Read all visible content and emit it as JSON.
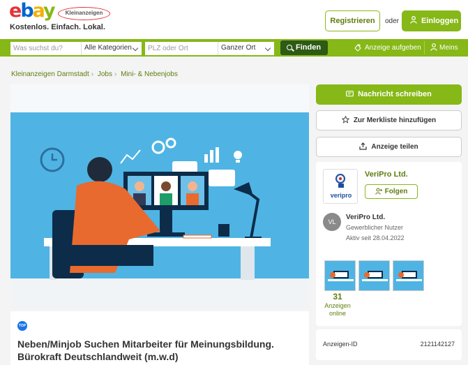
{
  "header": {
    "logo_ebay": "ebay",
    "logo_badge": "Kleinanzeigen",
    "tagline": "Kostenlos. Einfach. Lokal.",
    "register_label": "Registrieren",
    "or_label": "oder",
    "login_label": "Einloggen"
  },
  "search": {
    "query_placeholder": "Was suchst du?",
    "category_value": "Alle Kategorien",
    "location_placeholder": "PLZ oder Ort",
    "radius_value": "Ganzer Ort",
    "find_label": "Finden",
    "post_ad_label": "Anzeige aufgeben",
    "mine_label": "Meins"
  },
  "breadcrumb": [
    "Kleinanzeigen Darmstadt",
    "Jobs",
    "Mini- & Nebenjobs"
  ],
  "ad": {
    "badge": "TOP",
    "title": "Neben/Minjob Suchen Mitarbeiter für Meinungsbildung. Bürokraft Deutschlandweit (m.w.d)"
  },
  "actions": {
    "message": "Nachricht schreiben",
    "watchlist": "Zur Merkliste hinzufügen",
    "share": "Anzeige teilen"
  },
  "seller": {
    "logo_text": "veripro",
    "name": "VeriPro Ltd.",
    "follow_label": "Folgen",
    "avatar_initials": "VL",
    "user_name": "VeriPro Ltd.",
    "user_type": "Gewerblicher Nutzer",
    "active_since": "Aktiv seit 28.04.2022",
    "ads_count": "31",
    "ads_label_1": "Anzeigen",
    "ads_label_2": "online"
  },
  "details": {
    "id_label": "Anzeigen-ID",
    "id_value": "2121142127"
  },
  "colors": {
    "brand_green": "#86b817",
    "dark_green": "#2d5a14",
    "link_green": "#5f7d0f"
  }
}
